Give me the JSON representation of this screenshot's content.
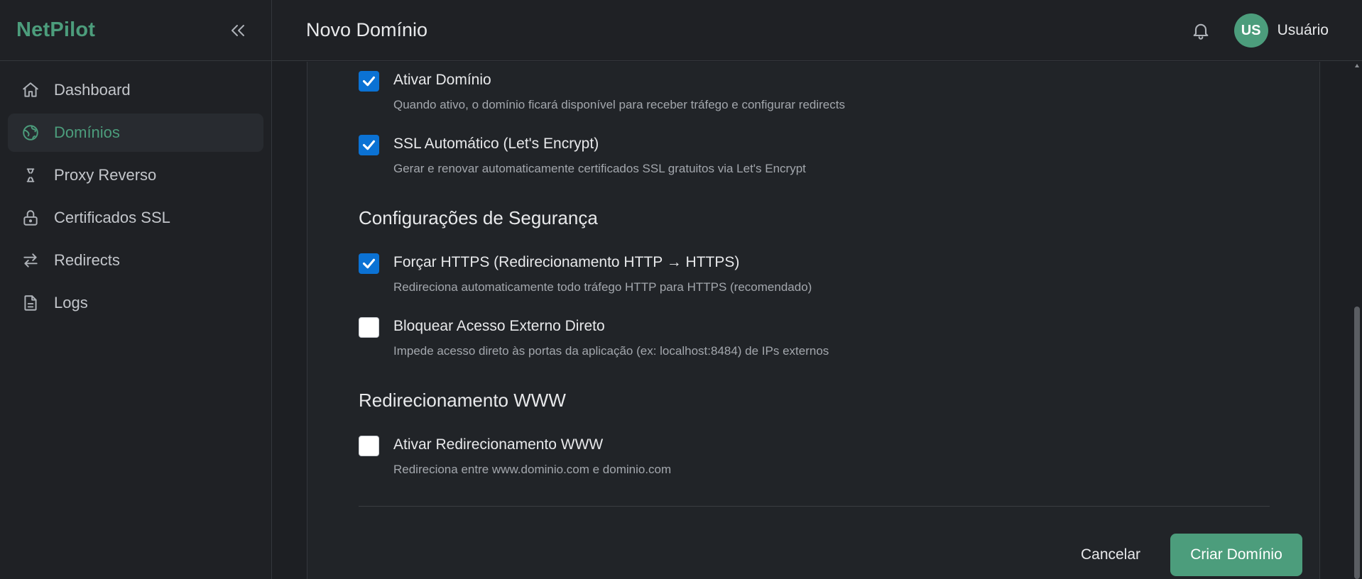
{
  "sidebar": {
    "brand": "NetPilot",
    "items": [
      {
        "label": "Dashboard",
        "icon": "home-icon",
        "active": false
      },
      {
        "label": "Domínios",
        "icon": "globe-icon",
        "active": true
      },
      {
        "label": "Proxy Reverso",
        "icon": "proxy-icon",
        "active": false
      },
      {
        "label": "Certificados SSL",
        "icon": "lock-icon",
        "active": false
      },
      {
        "label": "Redirects",
        "icon": "arrows-swap-icon",
        "active": false
      },
      {
        "label": "Logs",
        "icon": "file-icon",
        "active": false
      }
    ]
  },
  "header": {
    "title": "Novo Domínio",
    "user": {
      "initials": "US",
      "name": "Usuário"
    }
  },
  "form": {
    "options_general": [
      {
        "label": "Ativar Domínio",
        "description": "Quando ativo, o domínio ficará disponível para receber tráfego e configurar redirects",
        "checked": true
      },
      {
        "label": "SSL Automático (Let's Encrypt)",
        "description": "Gerar e renovar automaticamente certificados SSL gratuitos via Let's Encrypt",
        "checked": true
      }
    ],
    "security": {
      "title": "Configurações de Segurança",
      "options": [
        {
          "label": "Forçar HTTPS (Redirecionamento HTTP → HTTPS)",
          "description": "Redireciona automaticamente todo tráfego HTTP para HTTPS (recomendado)",
          "checked": true
        },
        {
          "label": "Bloquear Acesso Externo Direto",
          "description": "Impede acesso direto às portas da aplicação (ex: localhost:8484) de IPs externos",
          "checked": false
        }
      ]
    },
    "www": {
      "title": "Redirecionamento WWW",
      "options": [
        {
          "label": "Ativar Redirecionamento WWW",
          "description": "Redireciona entre www.dominio.com e dominio.com",
          "checked": false
        }
      ]
    },
    "actions": {
      "cancel": "Cancelar",
      "submit": "Criar Domínio"
    }
  },
  "colors": {
    "accent": "#4c9d7c",
    "checkbox_checked": "#0b72d4",
    "background": "#1d1f23"
  }
}
